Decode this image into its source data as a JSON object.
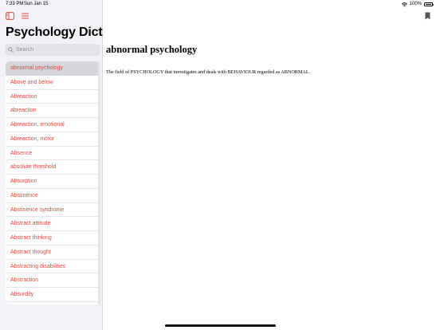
{
  "status_bar": {
    "time": "7:33 PM",
    "date": "Sun Jan 15",
    "battery": "100%"
  },
  "sidebar": {
    "title": "Psychology Dicti...",
    "search_placeholder": "Search",
    "items": [
      {
        "label": "abnormal psychology"
      },
      {
        "label": "Above and below"
      },
      {
        "label": "Abreaction"
      },
      {
        "label": "abreaction"
      },
      {
        "label": "Abreaction, emotional"
      },
      {
        "label": "Abreaction, motor"
      },
      {
        "label": "Absence"
      },
      {
        "label": "absolute threshold"
      },
      {
        "label": "Absorption"
      },
      {
        "label": "Abstinence"
      },
      {
        "label": "Abstinence syndrome"
      },
      {
        "label": "Abstract attitude"
      },
      {
        "label": "Abstract thinking"
      },
      {
        "label": "Abstract thought"
      },
      {
        "label": "Abstracting disabilities"
      },
      {
        "label": "Abstraction"
      },
      {
        "label": "Absurdity"
      }
    ],
    "selected_index": 0
  },
  "detail": {
    "term": "abnormal psychology",
    "definition": "The field of PSYCHOLOGY that investigates and deals with BEHAVIOUR regarded as ABNORMAL."
  },
  "colors": {
    "accent": "#e8473d",
    "sidebar_bg": "#f2f2f7",
    "selected_row": "#d5d5da",
    "search_bg": "#e3e3e8"
  },
  "icons": {
    "sidebar_toggle": "sidebar-toggle-icon",
    "menu": "list-menu-icon",
    "search": "search-icon",
    "bookmark": "bookmark-icon",
    "wifi": "wifi-icon",
    "battery": "battery-icon"
  }
}
